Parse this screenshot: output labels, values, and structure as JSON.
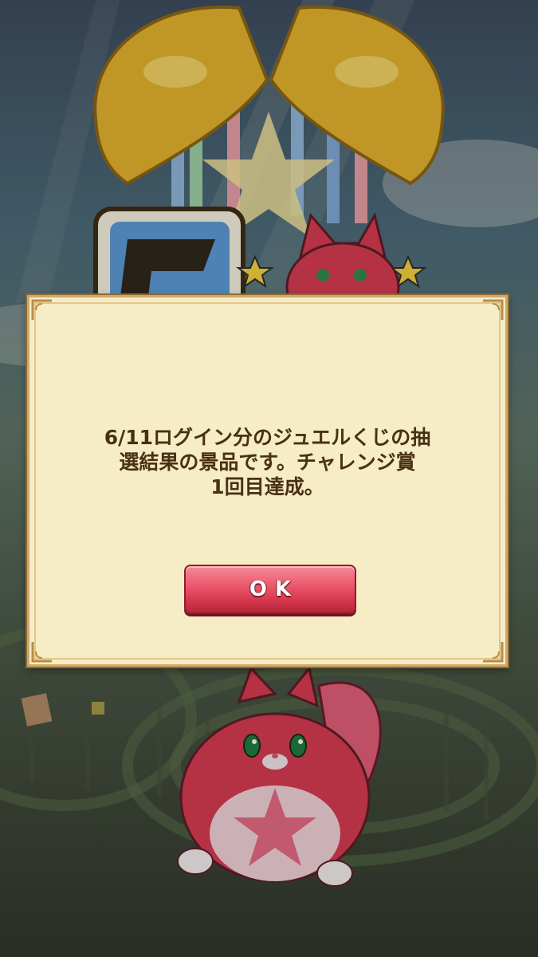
{
  "dialog": {
    "message_lines": [
      "6/11ログイン分のジュエルくじの抽",
      "選結果の景品です。チャレンジ賞",
      "1回目達成。"
    ],
    "ok_label": "OK"
  },
  "colors": {
    "dialog_bg": "#f6ecc6",
    "dialog_border": "#cfa967",
    "message_text": "#4a3015",
    "ok_button": "#e24d63",
    "mascot": "#d8384e"
  },
  "icons": [
    "gold-bell-icon",
    "star-icon",
    "rank-badge-icon",
    "cat-mascot-icon",
    "ornament-corner-icon"
  ]
}
